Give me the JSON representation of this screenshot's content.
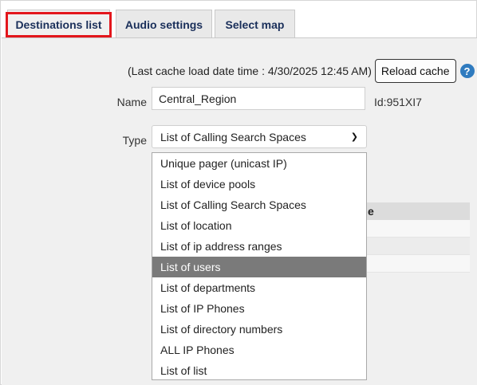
{
  "tabs": [
    {
      "label": "Destinations list",
      "active": true
    },
    {
      "label": "Audio settings",
      "active": false
    },
    {
      "label": "Select map",
      "active": false
    }
  ],
  "cache": {
    "text": "(Last cache load date time : 4/30/2025 12:45 AM)",
    "reload_label": "Reload cache",
    "help_glyph": "?"
  },
  "form": {
    "name_label": "Name",
    "name_value": "Central_Region",
    "id_text": "Id:951XI7",
    "type_label": "Type",
    "type_value": "List of Calling Search Spaces"
  },
  "table": {
    "header_fragment": "e"
  },
  "dropdown": {
    "options": [
      "Unique pager (unicast IP)",
      "List of device pools",
      "List of Calling Search Spaces",
      "List of location",
      "List of ip address ranges",
      "List of users",
      "List of departments",
      "List of IP Phones",
      "List of directory numbers",
      "ALL IP Phones",
      "List of list"
    ],
    "highlighted": "List of users"
  },
  "colors": {
    "active_tab_outline": "#e3161c",
    "tab_text": "#1a2f5a",
    "highlight": "#7a7a7a",
    "help_icon": "#2f7bbf"
  }
}
